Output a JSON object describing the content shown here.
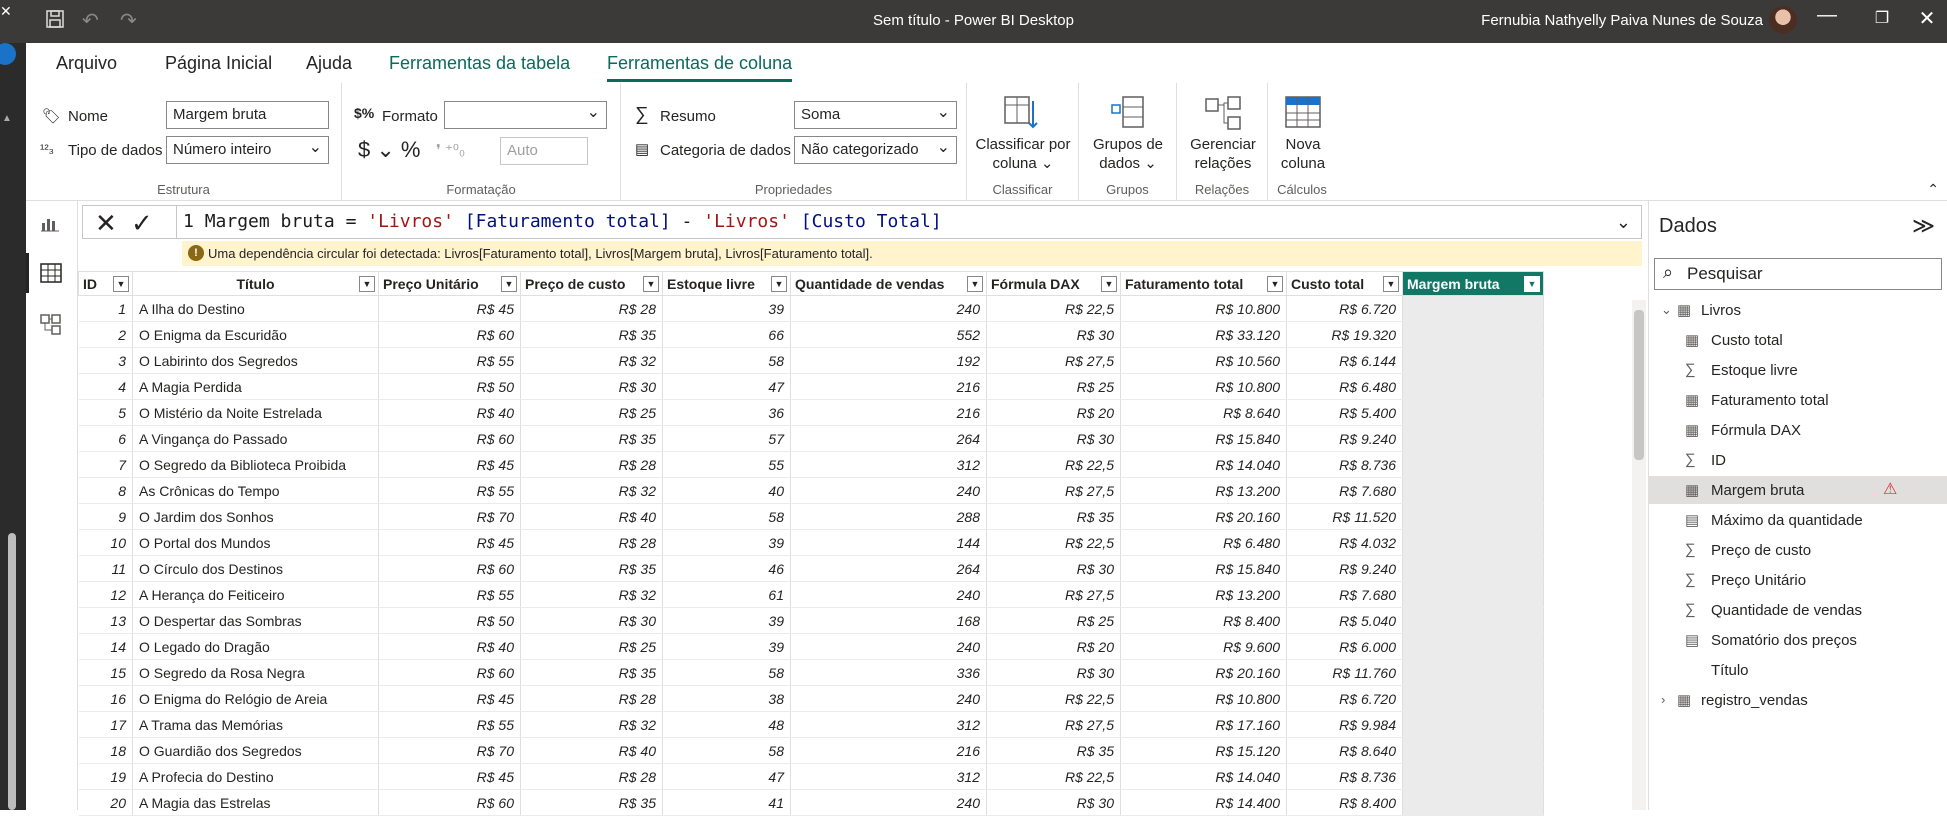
{
  "window": {
    "title": "Sem título - Power BI Desktop",
    "user": "Fernubia Nathyelly Paiva Nunes de Souza",
    "icons": [
      "save-icon",
      "undo-icon",
      "redo-icon",
      "minimize-icon",
      "restore-icon",
      "close-icon"
    ]
  },
  "menu": {
    "items": [
      "Arquivo",
      "Página Inicial",
      "Ajuda",
      "Ferramentas da tabela",
      "Ferramentas de coluna"
    ]
  },
  "ribbon": {
    "estrutura": {
      "name_label": "Nome",
      "name_value": "Margem bruta",
      "type_label": "Tipo de dados",
      "type_value": "Número inteiro",
      "group": "Estrutura"
    },
    "formatacao": {
      "format_label": "Formato",
      "format_value": "",
      "auto_value": "Auto",
      "group": "Formatação",
      "symbols": "$ ⌄ %"
    },
    "propriedades": {
      "summary_label": "Resumo",
      "summary_value": "Soma",
      "category_label": "Categoria de dados",
      "category_value": "Não categorizado",
      "group": "Propriedades"
    },
    "classificar": {
      "btn": "Classificar por coluna",
      "group": "Classificar"
    },
    "grupos": {
      "btn": "Grupos de dados",
      "group": "Grupos"
    },
    "relacoes": {
      "btn": "Gerenciar relações",
      "group": "Relações"
    },
    "calculos": {
      "btn": "Nova coluna",
      "group": "Cálculos"
    }
  },
  "formula": {
    "line": "1",
    "name": "Margem bruta =",
    "t1": "'Livros'",
    "c1": "[Faturamento total]",
    "op": "-",
    "t2": "'Livros'",
    "c2": "[Custo Total]"
  },
  "warning": "Uma dependência circular foi detectada: Livros[Faturamento total], Livros[Margem bruta], Livros[Faturamento total].",
  "table": {
    "columns": [
      "ID",
      "Título",
      "Preço Unitário",
      "Preço de custo",
      "Estoque livre",
      "Quantidade de vendas",
      "Fórmula DAX",
      "Faturamento total",
      "Custo total",
      "Margem bruta"
    ],
    "rows": [
      [
        "1",
        "A Ilha do Destino",
        "R$ 45",
        "R$ 28",
        "39",
        "240",
        "R$ 22,5",
        "R$ 10.800",
        "R$ 6.720"
      ],
      [
        "2",
        "O Enigma da Escuridão",
        "R$ 60",
        "R$ 35",
        "66",
        "552",
        "R$ 30",
        "R$ 33.120",
        "R$ 19.320"
      ],
      [
        "3",
        "O Labirinto dos Segredos",
        "R$ 55",
        "R$ 32",
        "58",
        "192",
        "R$ 27,5",
        "R$ 10.560",
        "R$ 6.144"
      ],
      [
        "4",
        "A Magia Perdida",
        "R$ 50",
        "R$ 30",
        "47",
        "216",
        "R$ 25",
        "R$ 10.800",
        "R$ 6.480"
      ],
      [
        "5",
        "O Mistério da Noite Estrelada",
        "R$ 40",
        "R$ 25",
        "36",
        "216",
        "R$ 20",
        "R$ 8.640",
        "R$ 5.400"
      ],
      [
        "6",
        "A Vingança do Passado",
        "R$ 60",
        "R$ 35",
        "57",
        "264",
        "R$ 30",
        "R$ 15.840",
        "R$ 9.240"
      ],
      [
        "7",
        "O Segredo da Biblioteca Proibida",
        "R$ 45",
        "R$ 28",
        "55",
        "312",
        "R$ 22,5",
        "R$ 14.040",
        "R$ 8.736"
      ],
      [
        "8",
        "As Crônicas do Tempo",
        "R$ 55",
        "R$ 32",
        "40",
        "240",
        "R$ 27,5",
        "R$ 13.200",
        "R$ 7.680"
      ],
      [
        "9",
        "O Jardim dos Sonhos",
        "R$ 70",
        "R$ 40",
        "58",
        "288",
        "R$ 35",
        "R$ 20.160",
        "R$ 11.520"
      ],
      [
        "10",
        "O Portal dos Mundos",
        "R$ 45",
        "R$ 28",
        "39",
        "144",
        "R$ 22,5",
        "R$ 6.480",
        "R$ 4.032"
      ],
      [
        "11",
        "O Círculo dos Destinos",
        "R$ 60",
        "R$ 35",
        "46",
        "264",
        "R$ 30",
        "R$ 15.840",
        "R$ 9.240"
      ],
      [
        "12",
        "A Herança do Feiticeiro",
        "R$ 55",
        "R$ 32",
        "61",
        "240",
        "R$ 27,5",
        "R$ 13.200",
        "R$ 7.680"
      ],
      [
        "13",
        "O Despertar das Sombras",
        "R$ 50",
        "R$ 30",
        "39",
        "168",
        "R$ 25",
        "R$ 8.400",
        "R$ 5.040"
      ],
      [
        "14",
        "O Legado do Dragão",
        "R$ 40",
        "R$ 25",
        "39",
        "240",
        "R$ 20",
        "R$ 9.600",
        "R$ 6.000"
      ],
      [
        "15",
        "O Segredo da Rosa Negra",
        "R$ 60",
        "R$ 35",
        "58",
        "336",
        "R$ 30",
        "R$ 20.160",
        "R$ 11.760"
      ],
      [
        "16",
        "O Enigma do Relógio de Areia",
        "R$ 45",
        "R$ 28",
        "38",
        "240",
        "R$ 22,5",
        "R$ 10.800",
        "R$ 6.720"
      ],
      [
        "17",
        "A Trama das Memórias",
        "R$ 55",
        "R$ 32",
        "48",
        "312",
        "R$ 27,5",
        "R$ 17.160",
        "R$ 9.984"
      ],
      [
        "18",
        "O Guardião dos Segredos",
        "R$ 70",
        "R$ 40",
        "58",
        "216",
        "R$ 35",
        "R$ 15.120",
        "R$ 8.640"
      ],
      [
        "19",
        "A Profecia do Destino",
        "R$ 45",
        "R$ 28",
        "47",
        "312",
        "R$ 22,5",
        "R$ 14.040",
        "R$ 8.736"
      ],
      [
        "20",
        "A Magia das Estrelas",
        "R$ 60",
        "R$ 35",
        "41",
        "240",
        "R$ 30",
        "R$ 14.400",
        "R$ 8.400"
      ]
    ]
  },
  "pane": {
    "title": "Dados",
    "search_placeholder": "Pesquisar",
    "tables": [
      {
        "name": "Livros",
        "expanded": true,
        "fields": [
          {
            "name": "Custo total",
            "icon": "calc-column-icon"
          },
          {
            "name": "Estoque livre",
            "icon": "sigma-icon"
          },
          {
            "name": "Faturamento total",
            "icon": "calc-column-icon"
          },
          {
            "name": "Fórmula DAX",
            "icon": "calc-column-icon"
          },
          {
            "name": "ID",
            "icon": "sigma-icon"
          },
          {
            "name": "Margem bruta",
            "icon": "calc-column-icon",
            "warning": true
          },
          {
            "name": "Máximo da quantidade",
            "icon": "measure-icon"
          },
          {
            "name": "Preço de custo",
            "icon": "sigma-icon"
          },
          {
            "name": "Preço Unitário",
            "icon": "sigma-icon"
          },
          {
            "name": "Quantidade de vendas",
            "icon": "sigma-icon"
          },
          {
            "name": "Somatório dos preços",
            "icon": "measure-icon"
          },
          {
            "name": "Título",
            "icon": "none"
          }
        ]
      },
      {
        "name": "registro_vendas",
        "expanded": false
      }
    ]
  }
}
